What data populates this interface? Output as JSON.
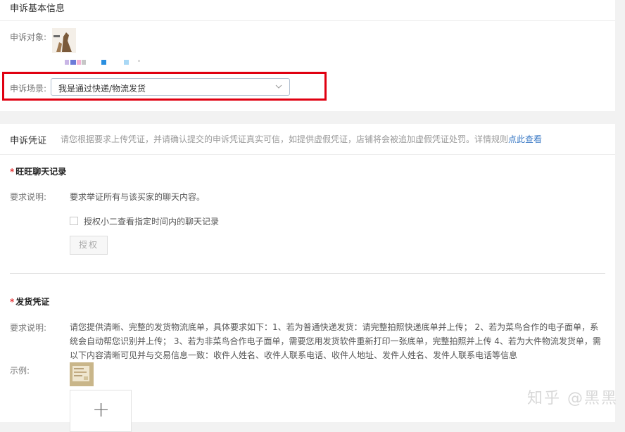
{
  "basic": {
    "title": "申诉基本信息",
    "target_label": "申诉对象:",
    "scene_label": "申诉场景:",
    "scene_value": "我是通过快递/物流发货"
  },
  "evidence": {
    "title": "申诉凭证",
    "intro": "请您根据要求上传凭证，并请确认提交的申诉凭证真实可信，如提供虚假凭证，店铺将会被追加虚假凭证处罚。详情规则",
    "intro_link": "点此查看",
    "chat": {
      "required_mark": "*",
      "title": "旺旺聊天记录",
      "desc_label": "要求说明:",
      "desc": "要求举证所有与该买家的聊天内容。",
      "checkbox_label": "授权小二查看指定时间内的聊天记录",
      "authorize_button": "授权"
    },
    "shipping": {
      "required_mark": "*",
      "title": "发货凭证",
      "desc_label": "要求说明:",
      "desc": "请您提供清晰、完整的发货物流底单，具体要求如下：1、若为普通快递发货：请完整拍照快递底单并上传； 2、若为菜鸟合作的电子面单，系统会自动帮您识别并上传； 3、若为非菜鸟合作电子面单，需要您用发货软件重新打印一张底单，完整拍照并上传 4、若为大件物流发货单，需以下内容清晰可见并与交易信息一致：收件人姓名、收件人联系电话、收件人地址、发件人姓名、发件人联系电话等信息",
      "example_label": "示例:",
      "upload_symbol": "+"
    }
  },
  "watermark": "知乎 @黑黑",
  "colors": {
    "highlight": "#e00011",
    "link": "#3a79c5",
    "required": "#e4393c"
  }
}
